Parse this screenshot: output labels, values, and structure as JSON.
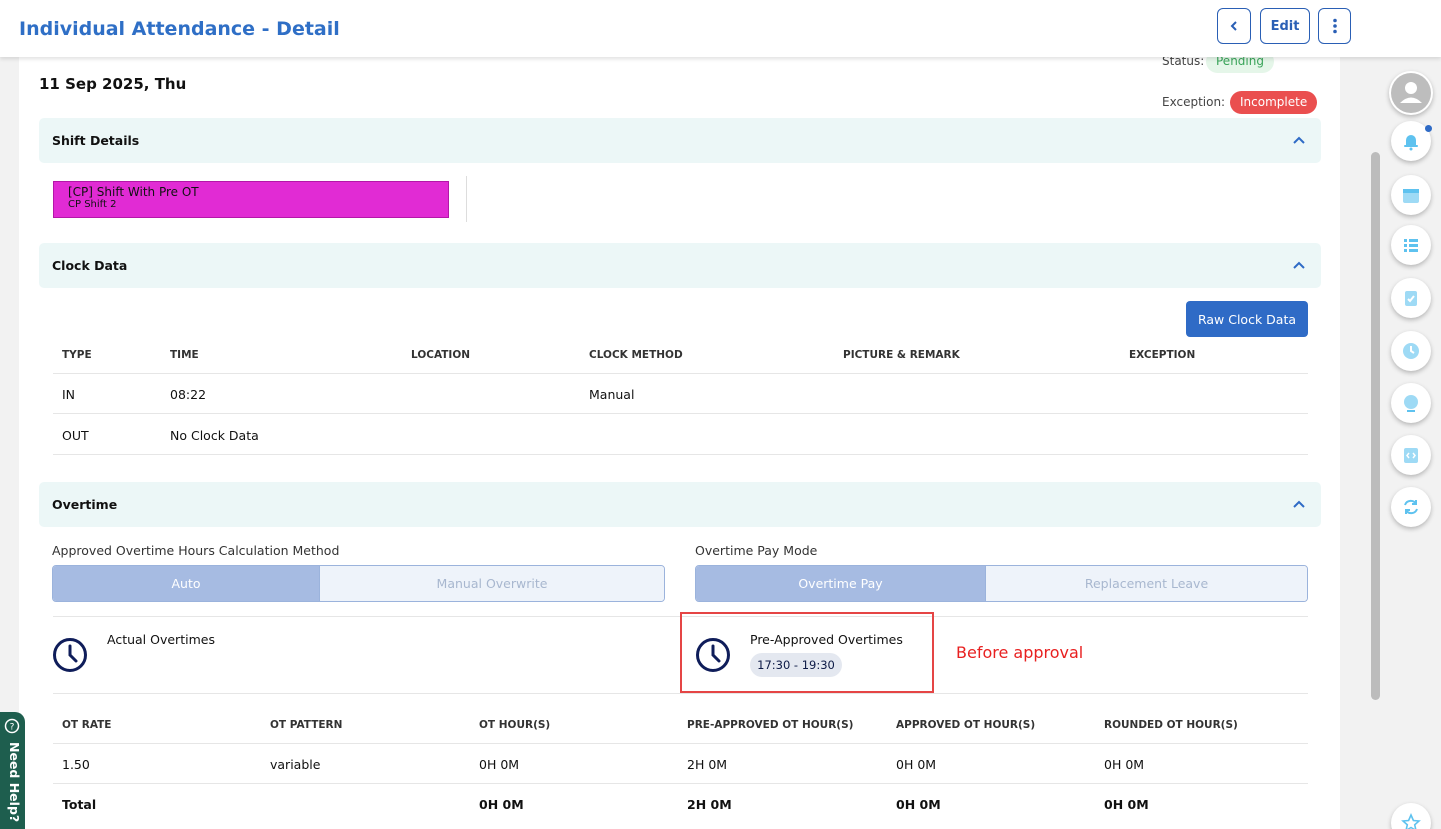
{
  "header": {
    "title": "Individual Attendance - Detail",
    "edit_label": "Edit"
  },
  "date": "11 Sep 2025, Thu",
  "status": {
    "label": "Status:",
    "value": "Pending",
    "color": "#3aa55a",
    "bg": "#e5f6e9"
  },
  "exception": {
    "label": "Exception:",
    "value": "Incomplete",
    "color": "#ffffff",
    "bg": "#ea4f4f"
  },
  "shift_details": {
    "title": "Shift Details",
    "shift_name": "[CP] Shift With Pre OT",
    "shift_code": "CP Shift 2",
    "shift_color": "#e12bd4"
  },
  "clock_data": {
    "title": "Clock Data",
    "raw_button": "Raw Clock Data",
    "columns": [
      "TYPE",
      "TIME",
      "LOCATION",
      "CLOCK METHOD",
      "PICTURE & REMARK",
      "EXCEPTION"
    ],
    "rows": [
      {
        "type": "IN",
        "time": "08:22",
        "location": "",
        "method": "Manual",
        "remark": "",
        "exception": ""
      },
      {
        "type": "OUT",
        "time": "No Clock Data",
        "location": "",
        "method": "",
        "remark": "",
        "exception": ""
      }
    ]
  },
  "overtime": {
    "title": "Overtime",
    "calc_label": "Approved Overtime Hours Calculation Method",
    "calc_options": [
      "Auto",
      "Manual Overwrite"
    ],
    "calc_selected": "Auto",
    "pay_label": "Overtime Pay Mode",
    "pay_options": [
      "Overtime Pay",
      "Replacement Leave"
    ],
    "pay_selected": "Overtime Pay",
    "actual_title": "Actual Overtimes",
    "preapproved_title": "Pre-Approved Overtimes",
    "preapproved_time": "17:30 - 19:30",
    "annotation": "Before approval",
    "columns": [
      "OT RATE",
      "OT PATTERN",
      "OT HOUR(S)",
      "PRE-APPROVED OT HOUR(S)",
      "APPROVED OT HOUR(S)",
      "ROUNDED OT HOUR(S)"
    ],
    "rows": [
      {
        "rate": "1.50",
        "pattern": "variable",
        "ot": "0H 0M",
        "pre": "2H 0M",
        "approved": "0H 0M",
        "rounded": "0H 0M"
      }
    ],
    "total": {
      "label": "Total",
      "ot": "0H 0M",
      "pre": "2H 0M",
      "approved": "0H 0M",
      "rounded": "0H 0M"
    }
  },
  "help": {
    "label": "Need Help?"
  },
  "colors": {
    "accent": "#2f6bc6",
    "title": "#2f6fc6",
    "section_bg": "#ecf7f7",
    "annotation": "#e82020"
  },
  "sidebar_icons": [
    "user-avatar-icon",
    "bell-icon",
    "calendar-icon",
    "list-icon",
    "clipboard-check-icon",
    "clock-icon",
    "globe-icon",
    "code-icon",
    "refresh-icon",
    "star-icon"
  ]
}
